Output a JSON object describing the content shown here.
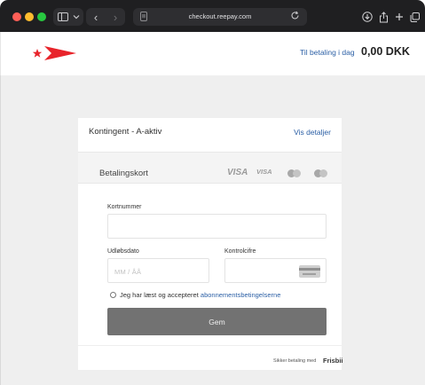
{
  "browser": {
    "url": "checkout.reepay.com",
    "icons": [
      "sidebar-icon",
      "chevron-down-icon",
      "back-arrow-icon",
      "forward-arrow-icon",
      "tab-icon",
      "reload-icon",
      "download-icon",
      "share-icon",
      "new-tab-icon",
      "tabs-overview-icon"
    ]
  },
  "header": {
    "logo_icon": "star-arrow-logo",
    "amount_label": "Til betaling i dag",
    "amount_value": "0,00 DKK"
  },
  "plan": {
    "name": "Kontingent - A-aktiv",
    "details_link": "Vis detaljer"
  },
  "payment_method": {
    "label": "Betalingskort",
    "brands": [
      "VISA",
      "VISA",
      "mastercard",
      "maestro"
    ]
  },
  "form": {
    "card_number_label": "Kortnummer",
    "card_number_value": "",
    "expiry_label": "Udløbsdato",
    "expiry_placeholder": "MM / ÅÅ",
    "cvc_label": "Kontrolcifre",
    "cvc_value": "",
    "terms_prefix": "Jeg har læst og accepteret",
    "terms_link": "abonnementsbetingelserne",
    "terms_checked": false,
    "submit_label": "Gem"
  },
  "footer": {
    "secure_text": "Sikker betaling med",
    "brand": "Frisbii"
  },
  "colors": {
    "logo_red": "#e8242b",
    "link_blue": "#2b5fa5",
    "button_gray": "#727272",
    "page_background": "#efefef"
  }
}
